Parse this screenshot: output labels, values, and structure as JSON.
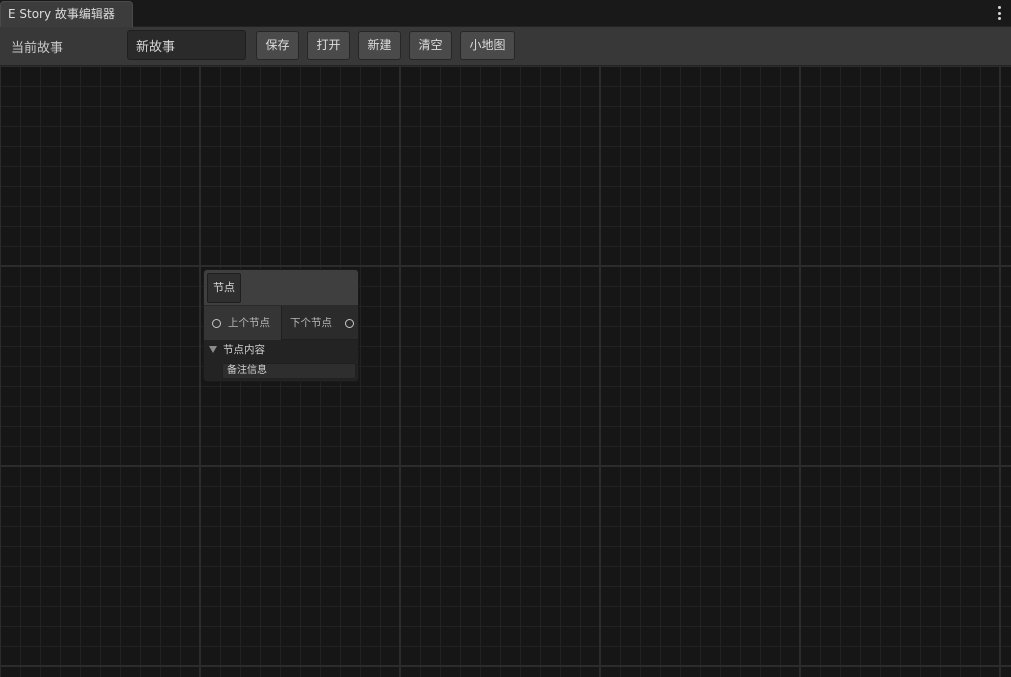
{
  "window": {
    "tab_title": "E Story 故事编辑器",
    "menu_icon": "kebab-menu-icon"
  },
  "toolbar": {
    "current_story_label": "当前故事",
    "story_name_value": "新故事",
    "buttons": {
      "save": "保存",
      "open": "打开",
      "new": "新建",
      "clear": "清空",
      "minimap": "小地图"
    }
  },
  "graph": {
    "node": {
      "title": "节点",
      "input_port": "上个节点",
      "output_port": "下个节点",
      "foldout_label": "节点内容",
      "note_field_value": "备注信息"
    }
  },
  "colors": {
    "canvas_background": "#161616",
    "toolbar_background": "#383838",
    "node_title_background": "#3f3f3f"
  }
}
